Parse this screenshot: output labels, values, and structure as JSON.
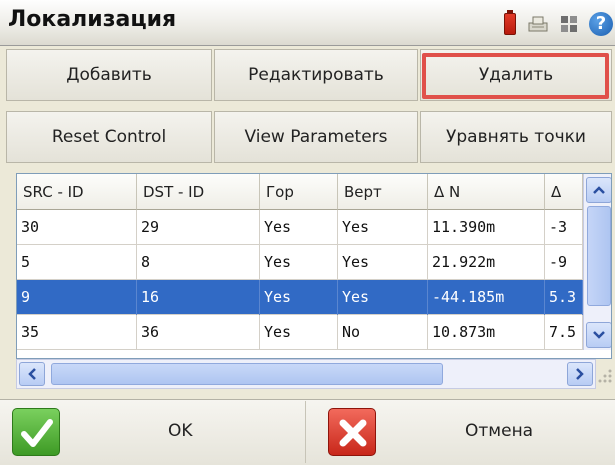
{
  "window": {
    "title": "Локализация",
    "help_label": "?"
  },
  "toolbar": {
    "add_label": "Добавить",
    "edit_label": "Редактировать",
    "delete_label": "Удалить",
    "reset_control_label": "Reset Control",
    "view_parameters_label": "View Parameters",
    "level_points_label": "Уравнять точки"
  },
  "table": {
    "columns": [
      "SRC - ID",
      "DST - ID",
      "Гор",
      "Верт",
      "Δ N",
      "Δ"
    ],
    "rows": [
      {
        "src": "30",
        "dst": "29",
        "hor": "Yes",
        "vert": "Yes",
        "dn": "11.390m",
        "de": "-3"
      },
      {
        "src": "5",
        "dst": "8",
        "hor": "Yes",
        "vert": "Yes",
        "dn": "21.922m",
        "de": "-9"
      },
      {
        "src": "9",
        "dst": "16",
        "hor": "Yes",
        "vert": "Yes",
        "dn": "-44.185m",
        "de": "5.3"
      },
      {
        "src": "35",
        "dst": "36",
        "hor": "Yes",
        "vert": "No",
        "dn": "10.873m",
        "de": "7.5"
      }
    ],
    "selected_row_index": 2
  },
  "footer": {
    "ok_label": "OK",
    "cancel_label": "Отмена"
  },
  "colors": {
    "selection": "#316ac5",
    "highlight_border": "#e0504a"
  },
  "icons": {
    "battery": "battery-icon",
    "device": "device-icon",
    "grid": "grid-icon",
    "help": "help-icon",
    "ok": "checkmark-icon",
    "cancel": "x-icon"
  }
}
